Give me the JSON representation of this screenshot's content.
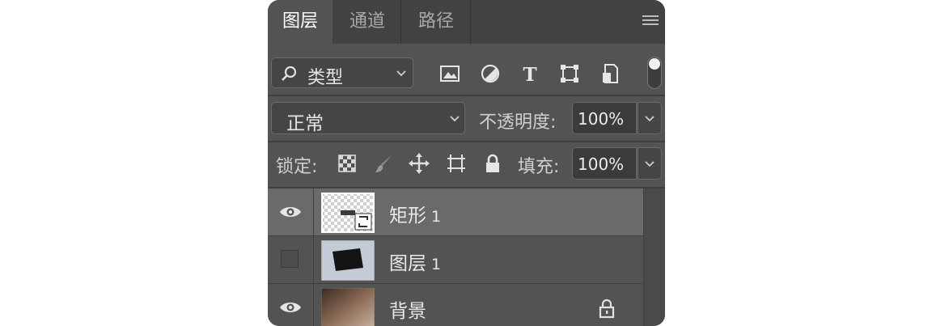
{
  "tabs": [
    {
      "label": "图层",
      "active": true
    },
    {
      "label": "通道",
      "active": false
    },
    {
      "label": "路径",
      "active": false
    }
  ],
  "filter": {
    "kind_label": "类型",
    "icons": [
      "image-filter-icon",
      "adjustment-filter-icon",
      "text-filter-icon",
      "shape-filter-icon",
      "smart-object-filter-icon"
    ],
    "toggle_on": true
  },
  "blend": {
    "mode": "正常",
    "opacity_label": "不透明度:",
    "opacity_value": "100%"
  },
  "lock": {
    "label": "锁定:",
    "icons": [
      "lock-transparent-pixels-icon",
      "lock-image-pixels-icon",
      "lock-position-icon",
      "lock-artboard-icon",
      "lock-all-icon"
    ],
    "fill_label": "填充:",
    "fill_value": "100%"
  },
  "layers": [
    {
      "name": "矩形",
      "number": "1",
      "visible": true,
      "selected": true,
      "locked": false,
      "thumb": "smart-object"
    },
    {
      "name": "图层",
      "number": "1",
      "visible": false,
      "selected": false,
      "locked": false,
      "thumb": "paper"
    },
    {
      "name": "背景",
      "number": "",
      "visible": true,
      "selected": false,
      "locked": true,
      "thumb": "texture"
    }
  ],
  "colors": {
    "panel_bg": "#535353",
    "tabbar_bg": "#424242",
    "selected_row": "#6a6a6a"
  }
}
